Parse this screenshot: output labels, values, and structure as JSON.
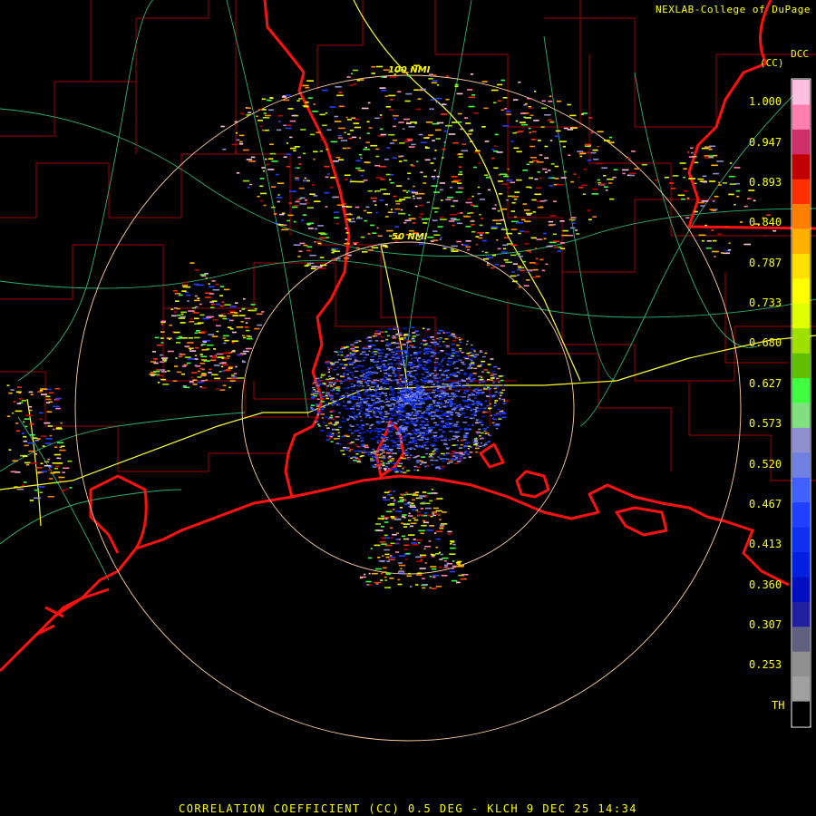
{
  "header": {
    "credit": "NEXLAB-College of DuPage",
    "product_code": "DCC",
    "product_abbrev": "(CC)"
  },
  "range_rings": [
    {
      "label": "50 NMI",
      "range_nmi": 50
    },
    {
      "label": "100 NMI",
      "range_nmi": 100
    }
  ],
  "legend": {
    "labels": [
      "1.000",
      "0.947",
      "0.893",
      "0.840",
      "0.787",
      "0.733",
      "0.680",
      "0.627",
      "0.573",
      "0.520",
      "0.467",
      "0.413",
      "0.360",
      "0.307",
      "0.253",
      "TH"
    ],
    "colors": [
      "#ffc0e0",
      "#ff80b0",
      "#d0306a",
      "#c00000",
      "#ff3000",
      "#ff8000",
      "#ffb000",
      "#ffe000",
      "#ffff00",
      "#e0ff00",
      "#a0e000",
      "#60c000",
      "#40ff40",
      "#80e080",
      "#9090d0",
      "#7080e0",
      "#4060ff",
      "#2040ff",
      "#1030f0",
      "#0020e0",
      "#0010c0",
      "#2020a0",
      "#606080",
      "#909090",
      "#a0a0a0",
      "#000000"
    ]
  },
  "footer": {
    "caption": "CORRELATION COEFFICIENT (CC) 0.5 DEG - KLCH 9 DEC 25 14:34"
  },
  "colors": {
    "ring": "#ffd0a0",
    "county_lines": "#b00000",
    "state_lines": "#ff2020",
    "highways": "#ffff40",
    "roads": "#40c080",
    "text": "#ffff00"
  },
  "icons": [
    "radar-site-icon"
  ]
}
